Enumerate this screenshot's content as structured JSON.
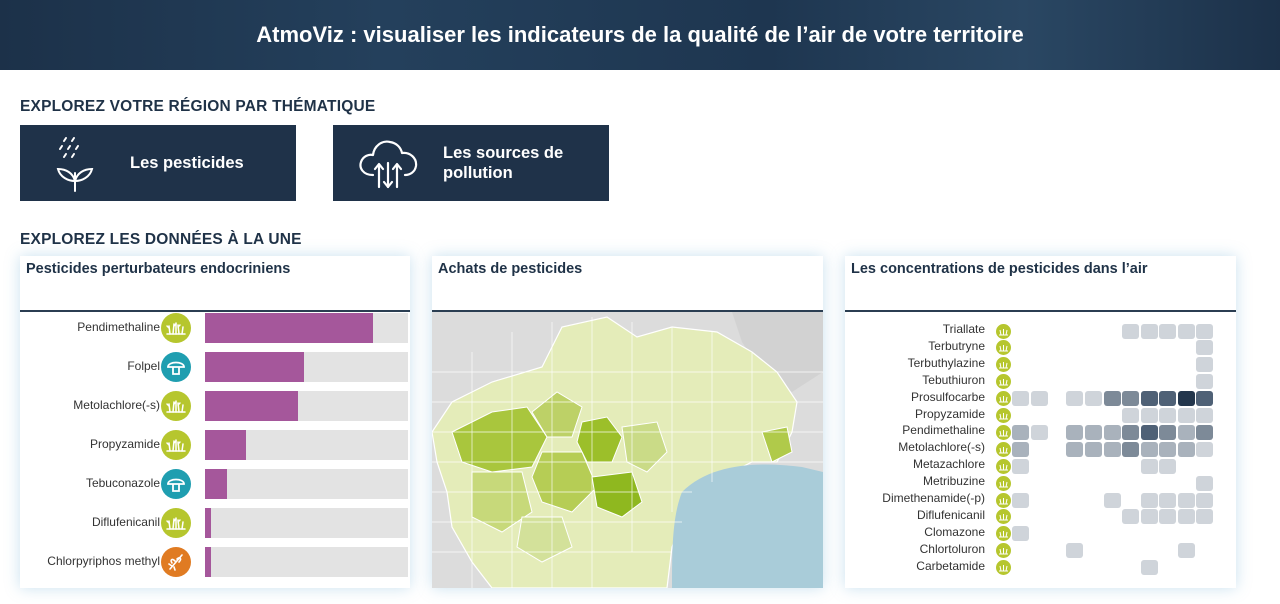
{
  "banner": {
    "title": "AtmoViz : visualiser les indicateurs de la qualité de l’air de votre territoire"
  },
  "explore_region": {
    "title": "EXPLOREZ VOTRE RÉGION PAR THÉMATIQUE",
    "tiles": [
      {
        "label": "Les pesticides",
        "icon": "plant-rain-icon"
      },
      {
        "label": "Les sources de pollution",
        "icon": "cloud-arrows-icon"
      }
    ]
  },
  "explore_data": {
    "title": "EXPLOREZ LES DONNÉES À LA UNE"
  },
  "card_endocrine": {
    "title": "Pesticides perturbateurs endocriniens",
    "colors": {
      "bar": "#a5579b",
      "track": "#e3e3e3",
      "herbicide": "#b6c62e",
      "fungicide": "#1f9eb0",
      "insecticide": "#e07b22"
    },
    "items": [
      {
        "name": "Pendimethaline",
        "type": "herbicide",
        "value": 0.83
      },
      {
        "name": "Folpel",
        "type": "fungicide",
        "value": 0.49
      },
      {
        "name": "Metolachlore(-s)",
        "type": "herbicide",
        "value": 0.46
      },
      {
        "name": "Propyzamide",
        "type": "herbicide",
        "value": 0.2
      },
      {
        "name": "Tebuconazole",
        "type": "fungicide",
        "value": 0.11
      },
      {
        "name": "Diflufenicanil",
        "type": "herbicide",
        "value": 0.03
      },
      {
        "name": "Chlorpyriphos methyl",
        "type": "insecticide",
        "value": 0.03
      }
    ]
  },
  "card_purchases": {
    "title": "Achats de pesticides"
  },
  "card_concentrations": {
    "title": "Les concentrations de pesticides dans l’air",
    "colors": {
      "levels": [
        "#cfd4da",
        "#a9b2bc",
        "#7d8a98",
        "#4f6176",
        "#23364c"
      ],
      "dot": "#b6c62e"
    },
    "rows": [
      {
        "name": "Triallate",
        "cells": [
          0,
          0,
          0,
          0,
          0,
          0,
          1,
          1,
          1,
          1,
          1
        ]
      },
      {
        "name": "Terbutryne",
        "cells": [
          0,
          0,
          0,
          0,
          0,
          0,
          0,
          0,
          0,
          0,
          1
        ]
      },
      {
        "name": "Terbuthylazine",
        "cells": [
          0,
          0,
          0,
          0,
          0,
          0,
          0,
          0,
          0,
          0,
          1
        ]
      },
      {
        "name": "Tebuthiuron",
        "cells": [
          0,
          0,
          0,
          0,
          0,
          0,
          0,
          0,
          0,
          0,
          1
        ]
      },
      {
        "name": "Prosulfocarbe",
        "cells": [
          1,
          1,
          0,
          1,
          1,
          3,
          3,
          4,
          4,
          5,
          4
        ]
      },
      {
        "name": "Propyzamide",
        "cells": [
          0,
          0,
          0,
          0,
          0,
          0,
          1,
          1,
          1,
          1,
          1
        ]
      },
      {
        "name": "Pendimethaline",
        "cells": [
          2,
          1,
          0,
          2,
          2,
          2,
          3,
          4,
          3,
          2,
          3
        ]
      },
      {
        "name": "Metolachlore(-s)",
        "cells": [
          2,
          0,
          0,
          2,
          2,
          2,
          3,
          2,
          2,
          2,
          1
        ]
      },
      {
        "name": "Metazachlore",
        "cells": [
          1,
          0,
          0,
          0,
          0,
          0,
          0,
          1,
          1,
          0,
          0
        ]
      },
      {
        "name": "Metribuzine",
        "cells": [
          0,
          0,
          0,
          0,
          0,
          0,
          0,
          0,
          0,
          0,
          1
        ]
      },
      {
        "name": "Dimethenamide(-p)",
        "cells": [
          1,
          0,
          0,
          0,
          0,
          1,
          0,
          1,
          1,
          1,
          1
        ]
      },
      {
        "name": "Diflufenicanil",
        "cells": [
          0,
          0,
          0,
          0,
          0,
          0,
          1,
          1,
          1,
          1,
          1
        ]
      },
      {
        "name": "Clomazone",
        "cells": [
          1,
          0,
          0,
          0,
          0,
          0,
          0,
          0,
          0,
          0,
          0
        ]
      },
      {
        "name": "Chlortoluron",
        "cells": [
          0,
          0,
          0,
          1,
          0,
          0,
          0,
          0,
          0,
          1,
          0
        ]
      },
      {
        "name": "Carbetamide",
        "cells": [
          0,
          0,
          0,
          0,
          0,
          0,
          0,
          1,
          0,
          0,
          0
        ]
      }
    ]
  }
}
